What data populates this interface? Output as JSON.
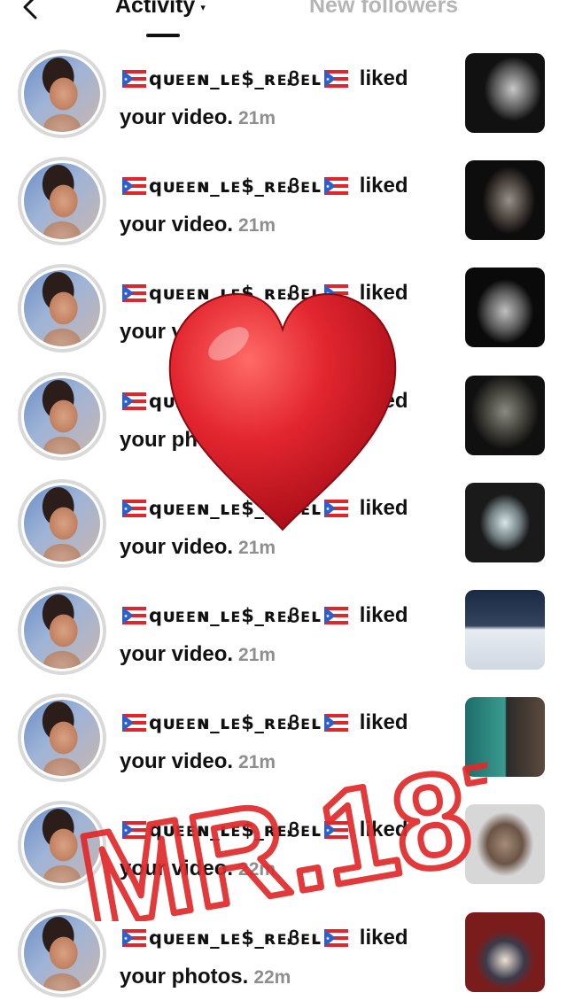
{
  "header": {
    "tab_activity": "Activity",
    "tab_activity_caret": "▾",
    "tab_followers": "New followers"
  },
  "notifications": [
    {
      "user": "qᴜᴇᴇɴ_ʟᴇ$_ʀᴇᏰᴇʟ",
      "verb": "liked",
      "object": "your video.",
      "time": "21m"
    },
    {
      "user": "qᴜᴇᴇɴ_ʟᴇ$_ʀᴇᏰᴇʟ",
      "verb": "liked",
      "object": "your video.",
      "time": "21m"
    },
    {
      "user": "qᴜᴇᴇɴ_ʟᴇ$_ʀᴇᏰᴇʟ",
      "verb": "liked",
      "object": "your video.",
      "time": "21m"
    },
    {
      "user": "qᴜᴇᴇɴ_ʟᴇ$_ʀᴇᏰᴇʟ",
      "verb": "liked",
      "object": "your photos.",
      "time": "21m"
    },
    {
      "user": "qᴜᴇᴇɴ_ʟᴇ$_ʀᴇᏰᴇʟ",
      "verb": "liked",
      "object": "your video.",
      "time": "21m"
    },
    {
      "user": "qᴜᴇᴇɴ_ʟᴇ$_ʀᴇᏰᴇʟ",
      "verb": "liked",
      "object": "your video.",
      "time": "21m"
    },
    {
      "user": "qᴜᴇᴇɴ_ʟᴇ$_ʀᴇᏰᴇʟ",
      "verb": "liked",
      "object": "your video.",
      "time": "21m"
    },
    {
      "user": "qᴜᴇᴇɴ_ʟᴇ$_ʀᴇᏰᴇʟ",
      "verb": "liked",
      "object": "your video.",
      "time": "22m"
    },
    {
      "user": "qᴜᴇᴇɴ_ʟᴇ$_ʀᴇᏰᴇʟ",
      "verb": "liked",
      "object": "your photos.",
      "time": "22m"
    }
  ],
  "watermark": {
    "text": "MR.187"
  },
  "icons": {
    "back": "chevron-left-icon",
    "flag": "puerto-rico-flag-icon",
    "heart": "red-heart-icon"
  },
  "colors": {
    "heart": "#e3262f",
    "watermark": "#e02a2a",
    "muted": "#8e8e8e",
    "inactive_tab": "#b5b5b5"
  }
}
